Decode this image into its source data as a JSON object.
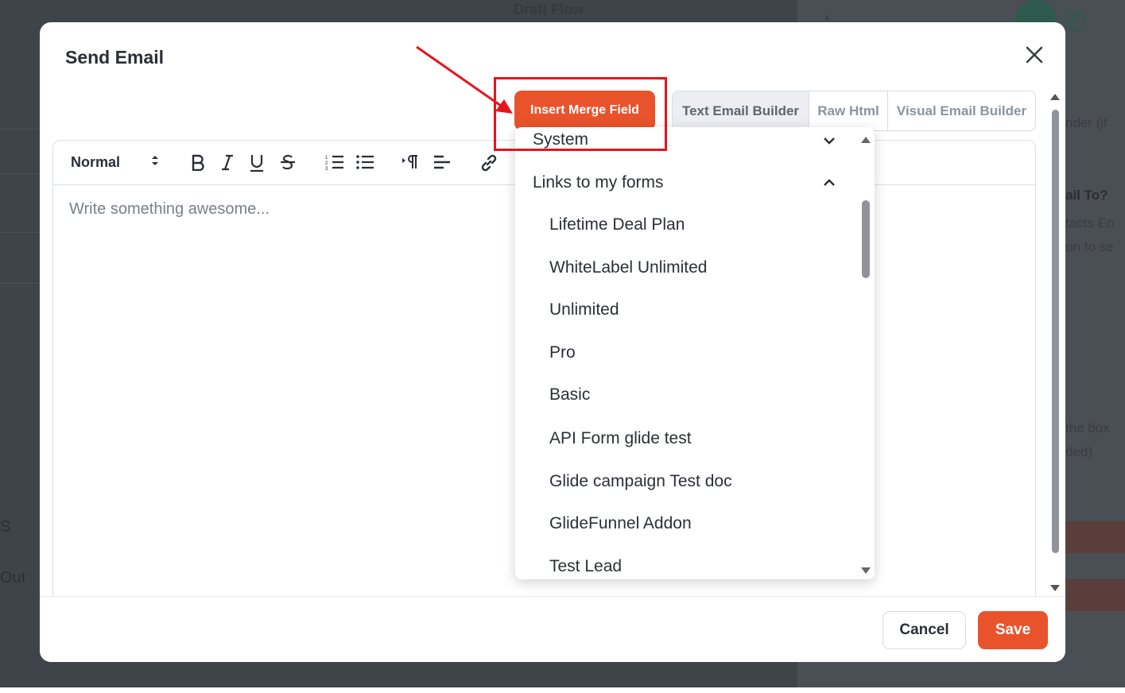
{
  "background": {
    "flow_title": "Draft Flow",
    "left_labels": [
      "S",
      "Out"
    ],
    "right_labels": [
      "nder (if",
      "ail To?",
      "tacts En",
      "on to se",
      "the box",
      "ded)"
    ]
  },
  "modal": {
    "title": "Send Email",
    "insert_merge_label": "Insert Merge Field",
    "builder_tabs": [
      "Text Email Builder",
      "Raw Html",
      "Visual Email Builder"
    ],
    "toolbar": {
      "format": "Normal"
    },
    "editor_placeholder": "Write something awesome...",
    "cancel_label": "Cancel",
    "save_label": "Save"
  },
  "merge_dropdown": {
    "sections": [
      {
        "label": "System",
        "expanded": false
      },
      {
        "label": "Links to my forms",
        "expanded": true
      }
    ],
    "items": [
      "Lifetime Deal Plan",
      "WhiteLabel Unlimited",
      "Unlimited",
      "Pro",
      "Basic",
      "API Form glide test",
      "Glide campaign Test doc",
      "GlideFunnel Addon",
      "Test Lead"
    ]
  },
  "colors": {
    "accent": "#e9532b",
    "annotation": "#e8141b"
  }
}
